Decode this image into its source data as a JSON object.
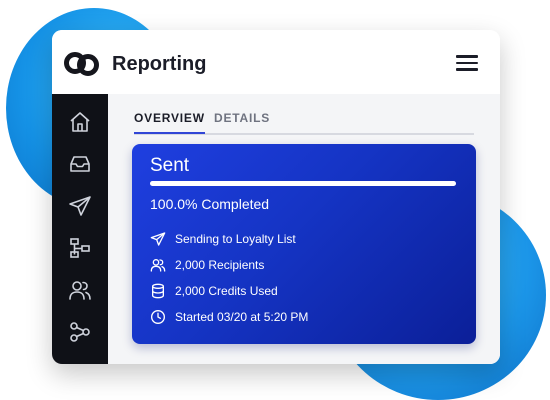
{
  "header": {
    "title": "Reporting",
    "logo_icon": "reporting-logo-icon",
    "menu_icon": "hamburger-menu-icon"
  },
  "sidebar": {
    "items": [
      {
        "icon": "home-icon"
      },
      {
        "icon": "inbox-icon"
      },
      {
        "icon": "send-icon"
      },
      {
        "icon": "workflow-icon"
      },
      {
        "icon": "users-icon"
      },
      {
        "icon": "share-icon"
      }
    ]
  },
  "tabs": {
    "overview": "OVERVIEW",
    "details": "DETAILS",
    "active": "OVERVIEW"
  },
  "status_card": {
    "title": "Sent",
    "progress_fraction": 1.0,
    "completed_text": "100.0% Completed",
    "rows": [
      {
        "icon": "send-icon",
        "text": "Sending to Loyalty List"
      },
      {
        "icon": "users-icon",
        "text": "2,000 Recipients"
      },
      {
        "icon": "database-icon",
        "text": "2,000 Credits Used"
      },
      {
        "icon": "clock-icon",
        "text": "Started 03/20 at 5:20 PM"
      }
    ]
  },
  "colors": {
    "accent": "#3146d6",
    "card_gradient_start": "#1f3fe0",
    "card_gradient_end": "#0b1f98",
    "sidebar_bg": "#0f1117",
    "decor_blue": "#1592e6"
  }
}
